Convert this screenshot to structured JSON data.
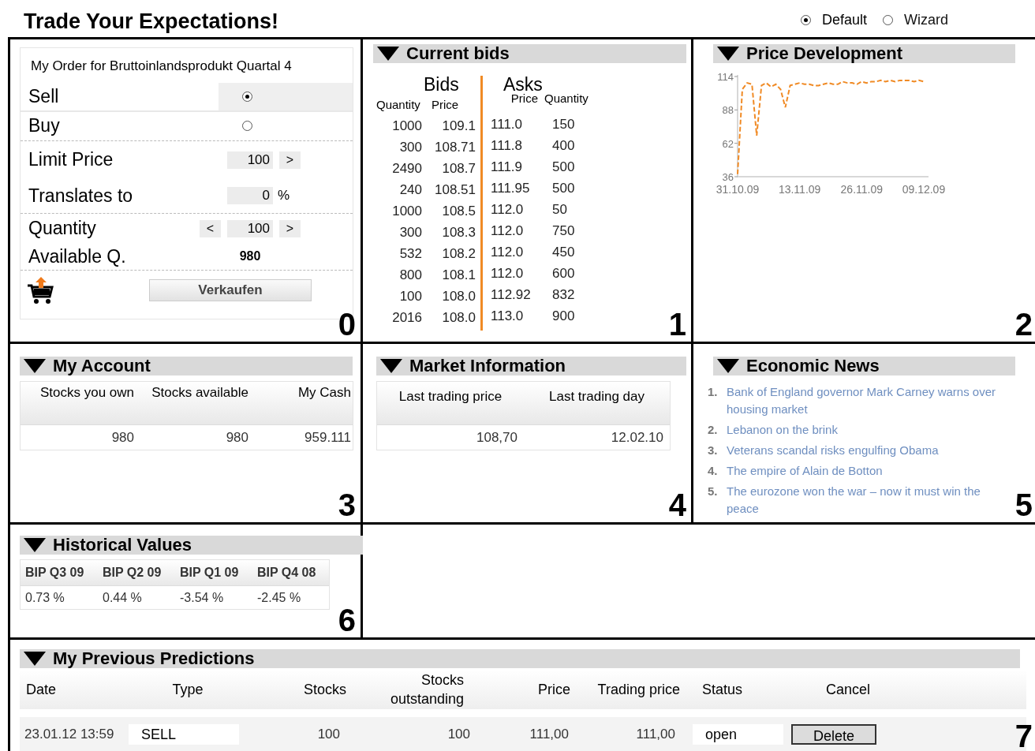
{
  "header": {
    "title": "Trade Your Expectations!",
    "view_options": [
      {
        "label": "Default",
        "selected": true
      },
      {
        "label": "Wizard",
        "selected": false
      }
    ]
  },
  "order": {
    "number": "0",
    "title": "My Order for Bruttoinlandsprodukt Quartal 4",
    "sides": [
      {
        "label": "Sell",
        "selected": true
      },
      {
        "label": "Buy",
        "selected": false
      }
    ],
    "limit_price": {
      "label": "Limit Price",
      "value": "100",
      "increase": ">"
    },
    "translates": {
      "label": "Translates to",
      "value": "0",
      "unit": "%"
    },
    "quantity": {
      "label": "Quantity",
      "decrease": "<",
      "value": "100",
      "increase": ">"
    },
    "available": {
      "label": "Available Q.",
      "value": "980"
    },
    "submit": "Verkaufen"
  },
  "bids": {
    "number": "1",
    "title": "Current bids",
    "bids_label": "Bids",
    "asks_label": "Asks",
    "bid_columns": [
      "Quantity",
      "Price"
    ],
    "ask_columns": [
      "Price",
      "Quantity"
    ],
    "rows": [
      [
        "1000",
        "109.1",
        "111.0",
        "150"
      ],
      [
        "300",
        "108.71",
        "111.8",
        "400"
      ],
      [
        "2490",
        "108.7",
        "111.9",
        "500"
      ],
      [
        "240",
        "108.51",
        "111.95",
        "500"
      ],
      [
        "1000",
        "108.5",
        "112.0",
        "50"
      ],
      [
        "300",
        "108.3",
        "112.0",
        "750"
      ],
      [
        "532",
        "108.2",
        "112.0",
        "450"
      ],
      [
        "800",
        "108.1",
        "112.0",
        "600"
      ],
      [
        "100",
        "108.0",
        "112.92",
        "832"
      ],
      [
        "2016",
        "108.0",
        "113.0",
        "900"
      ]
    ]
  },
  "price": {
    "number": "2",
    "title": "Price Development",
    "chart_data": {
      "type": "line",
      "categories": [
        "31.10.09",
        null,
        null,
        null,
        null,
        null,
        null,
        null,
        null,
        null,
        null,
        null,
        null,
        "13.11.09",
        null,
        null,
        null,
        null,
        null,
        null,
        null,
        null,
        null,
        null,
        null,
        null,
        "26.11.09",
        null,
        null,
        null,
        null,
        null,
        null,
        null,
        null,
        null,
        null,
        null,
        null,
        "09.12.09"
      ],
      "series": [
        {
          "color": "#f08a24",
          "line_style": "dashed",
          "values": [
            38,
            104,
            109,
            108,
            68,
            107,
            109,
            106,
            108,
            104,
            90,
            107,
            108,
            109,
            108,
            108,
            107,
            107,
            108,
            109,
            108,
            108,
            110,
            109,
            109,
            108,
            110,
            109,
            110,
            110,
            111,
            110,
            111,
            110,
            111,
            111,
            111,
            110,
            111,
            110
          ]
        }
      ],
      "ylim": [
        36,
        114
      ],
      "yticks": [
        36,
        62,
        88,
        114
      ]
    }
  },
  "account": {
    "number": "3",
    "title": "My Account",
    "columns": [
      "Stocks you own",
      "Stocks available",
      "My Cash"
    ],
    "values": [
      "980",
      "980",
      "959.111"
    ]
  },
  "market": {
    "number": "4",
    "title": "Market Information",
    "columns": [
      "Last trading price",
      "Last trading day"
    ],
    "values": [
      "108,70",
      "12.02.10"
    ]
  },
  "news": {
    "number": "5",
    "title": "Economic News",
    "items": [
      {
        "index": "1.",
        "text": "Bank of England governor Mark Carney warns over housing market"
      },
      {
        "index": "2.",
        "text": "Lebanon on the brink"
      },
      {
        "index": "3.",
        "text": "Veterans scandal risks engulfing Obama"
      },
      {
        "index": "4.",
        "text": "The empire of Alain de Botton"
      },
      {
        "index": "5.",
        "text": "The eurozone won the war – now it must win the peace"
      }
    ]
  },
  "history": {
    "number": "6",
    "title": "Historical Values",
    "columns": [
      "BIP Q3 09",
      "BIP Q2 09",
      "BIP Q1 09",
      "BIP Q4 08"
    ],
    "values": [
      "0.73 %",
      "0.44 %",
      "-3.54 %",
      "-2.45 %"
    ]
  },
  "predictions": {
    "number": "7",
    "title": "My Previous Predictions",
    "columns": [
      "Date",
      "Type",
      "Stocks",
      "Stocks outstanding",
      "Price",
      "Trading price",
      "Status",
      "Cancel"
    ],
    "rows": [
      {
        "date": "23.01.12 13:59",
        "type": "SELL",
        "stocks": "100",
        "outstanding": "100",
        "price": "111,00",
        "trading_price": "111,00",
        "status": "open",
        "action": "Delete"
      }
    ]
  }
}
